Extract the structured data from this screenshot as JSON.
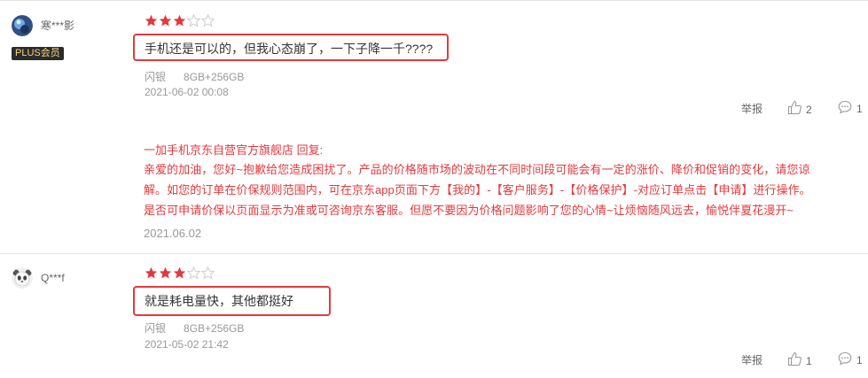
{
  "reviews": [
    {
      "username": "寒***影",
      "badge": "PLUS会员",
      "rating": 3,
      "max_rating": 5,
      "comment": "手机还是可以的，但我心态崩了，一下子降一千????",
      "spec_color": "闪银",
      "spec_storage": "8GB+256GB",
      "date": "2021-06-02 00:08",
      "report_label": "举报",
      "like_count": "2",
      "reply_count": "1",
      "reply": {
        "header": "一加手机京东自营官方旗舰店 回复:",
        "lines": [
          "亲爱的加油，您好~抱歉给您造成困扰了。产品的价格随市场的波动在不同时间段可能会有一定的涨价、降价和促销的变化，请您谅",
          "解。如您的订单在价保规则范围内，可在京东app页面下方【我的】-【客户服务】-【价格保护】-对应订单点击【申请】进行操作。",
          "是否可申请价保以页面显示为准或可咨询京东客服。但愿不要因为价格问题影响了您的心情~让烦恼随风远去，愉悦伴夏花漫开~"
        ],
        "date": "2021.06.02"
      }
    },
    {
      "username": "Q***f",
      "rating": 3,
      "max_rating": 5,
      "comment": "就是耗电量快，其他都挺好",
      "spec_color": "闪银",
      "spec_storage": "8GB+256GB",
      "date": "2021-05-02 21:42",
      "report_label": "举报",
      "like_count": "1",
      "reply_count": "1"
    }
  ],
  "colors": {
    "accent_red": "#e4393c",
    "star_empty": "#cccccc",
    "muted": "#999999"
  },
  "icons": [
    "user-avatar-icon",
    "panda-avatar-icon",
    "star-icon",
    "thumbs-up-icon",
    "comment-bubble-icon"
  ]
}
